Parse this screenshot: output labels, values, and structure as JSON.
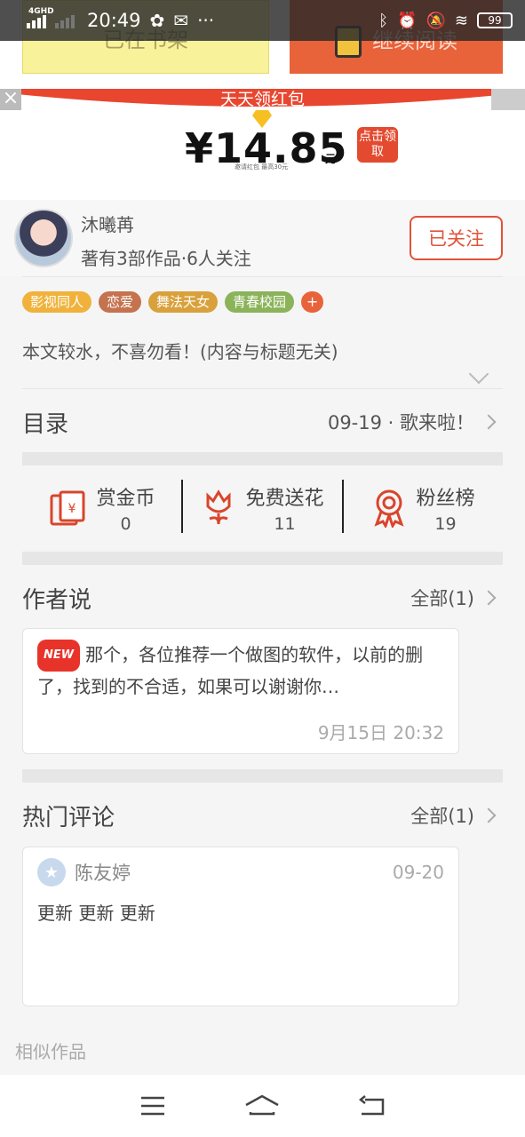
{
  "top_buttons": {
    "shelf_label": "已在书架",
    "read_label": "继续阅读"
  },
  "status_bar": {
    "network": "4GHD",
    "time": "20:49",
    "battery": "99"
  },
  "banner": {
    "title": "天天领红包",
    "currency": "¥",
    "amount": "14.85",
    "unit": "元",
    "note": "邀请红包 最高30元",
    "claim_label": "点击领取"
  },
  "author": {
    "name": "沐曦苒",
    "meta": "著有3部作品·6人关注",
    "follow_label": "已关注"
  },
  "tags": [
    {
      "label": "影视同人",
      "color": "#f0b23a"
    },
    {
      "label": "恋爱",
      "color": "#c5734f"
    },
    {
      "label": "舞法天女",
      "color": "#d9a13b"
    },
    {
      "label": "青春校园",
      "color": "#8bb35a"
    }
  ],
  "tag_add": "+",
  "description": "本文较水，不喜勿看！(内容与标题无关)",
  "catalog": {
    "title": "目录",
    "latest": "09-19 · 歌来啦！"
  },
  "stats": [
    {
      "label": "赏金币",
      "value": "0",
      "icon": "reward-envelope-icon"
    },
    {
      "label": "免费送花",
      "value": "11",
      "icon": "flower-icon"
    },
    {
      "label": "粉丝榜",
      "value": "19",
      "icon": "medal-icon"
    }
  ],
  "author_says": {
    "title": "作者说",
    "all_label": "全部(1)",
    "badge": "NEW",
    "text": "那个，各位推荐一个做图的软件，以前的删了，找到的不合适，如果可以谢谢你…",
    "time": "9月15日  20:32"
  },
  "hot_comments": {
    "title": "热门评论",
    "all_label": "全部(1)",
    "user": "陈友婷",
    "date": "09-20",
    "body": "更新  更新  更新"
  },
  "similar_title": "相似作品",
  "colors": {
    "accent": "#e0533a",
    "banner_red": "#e8462f"
  }
}
